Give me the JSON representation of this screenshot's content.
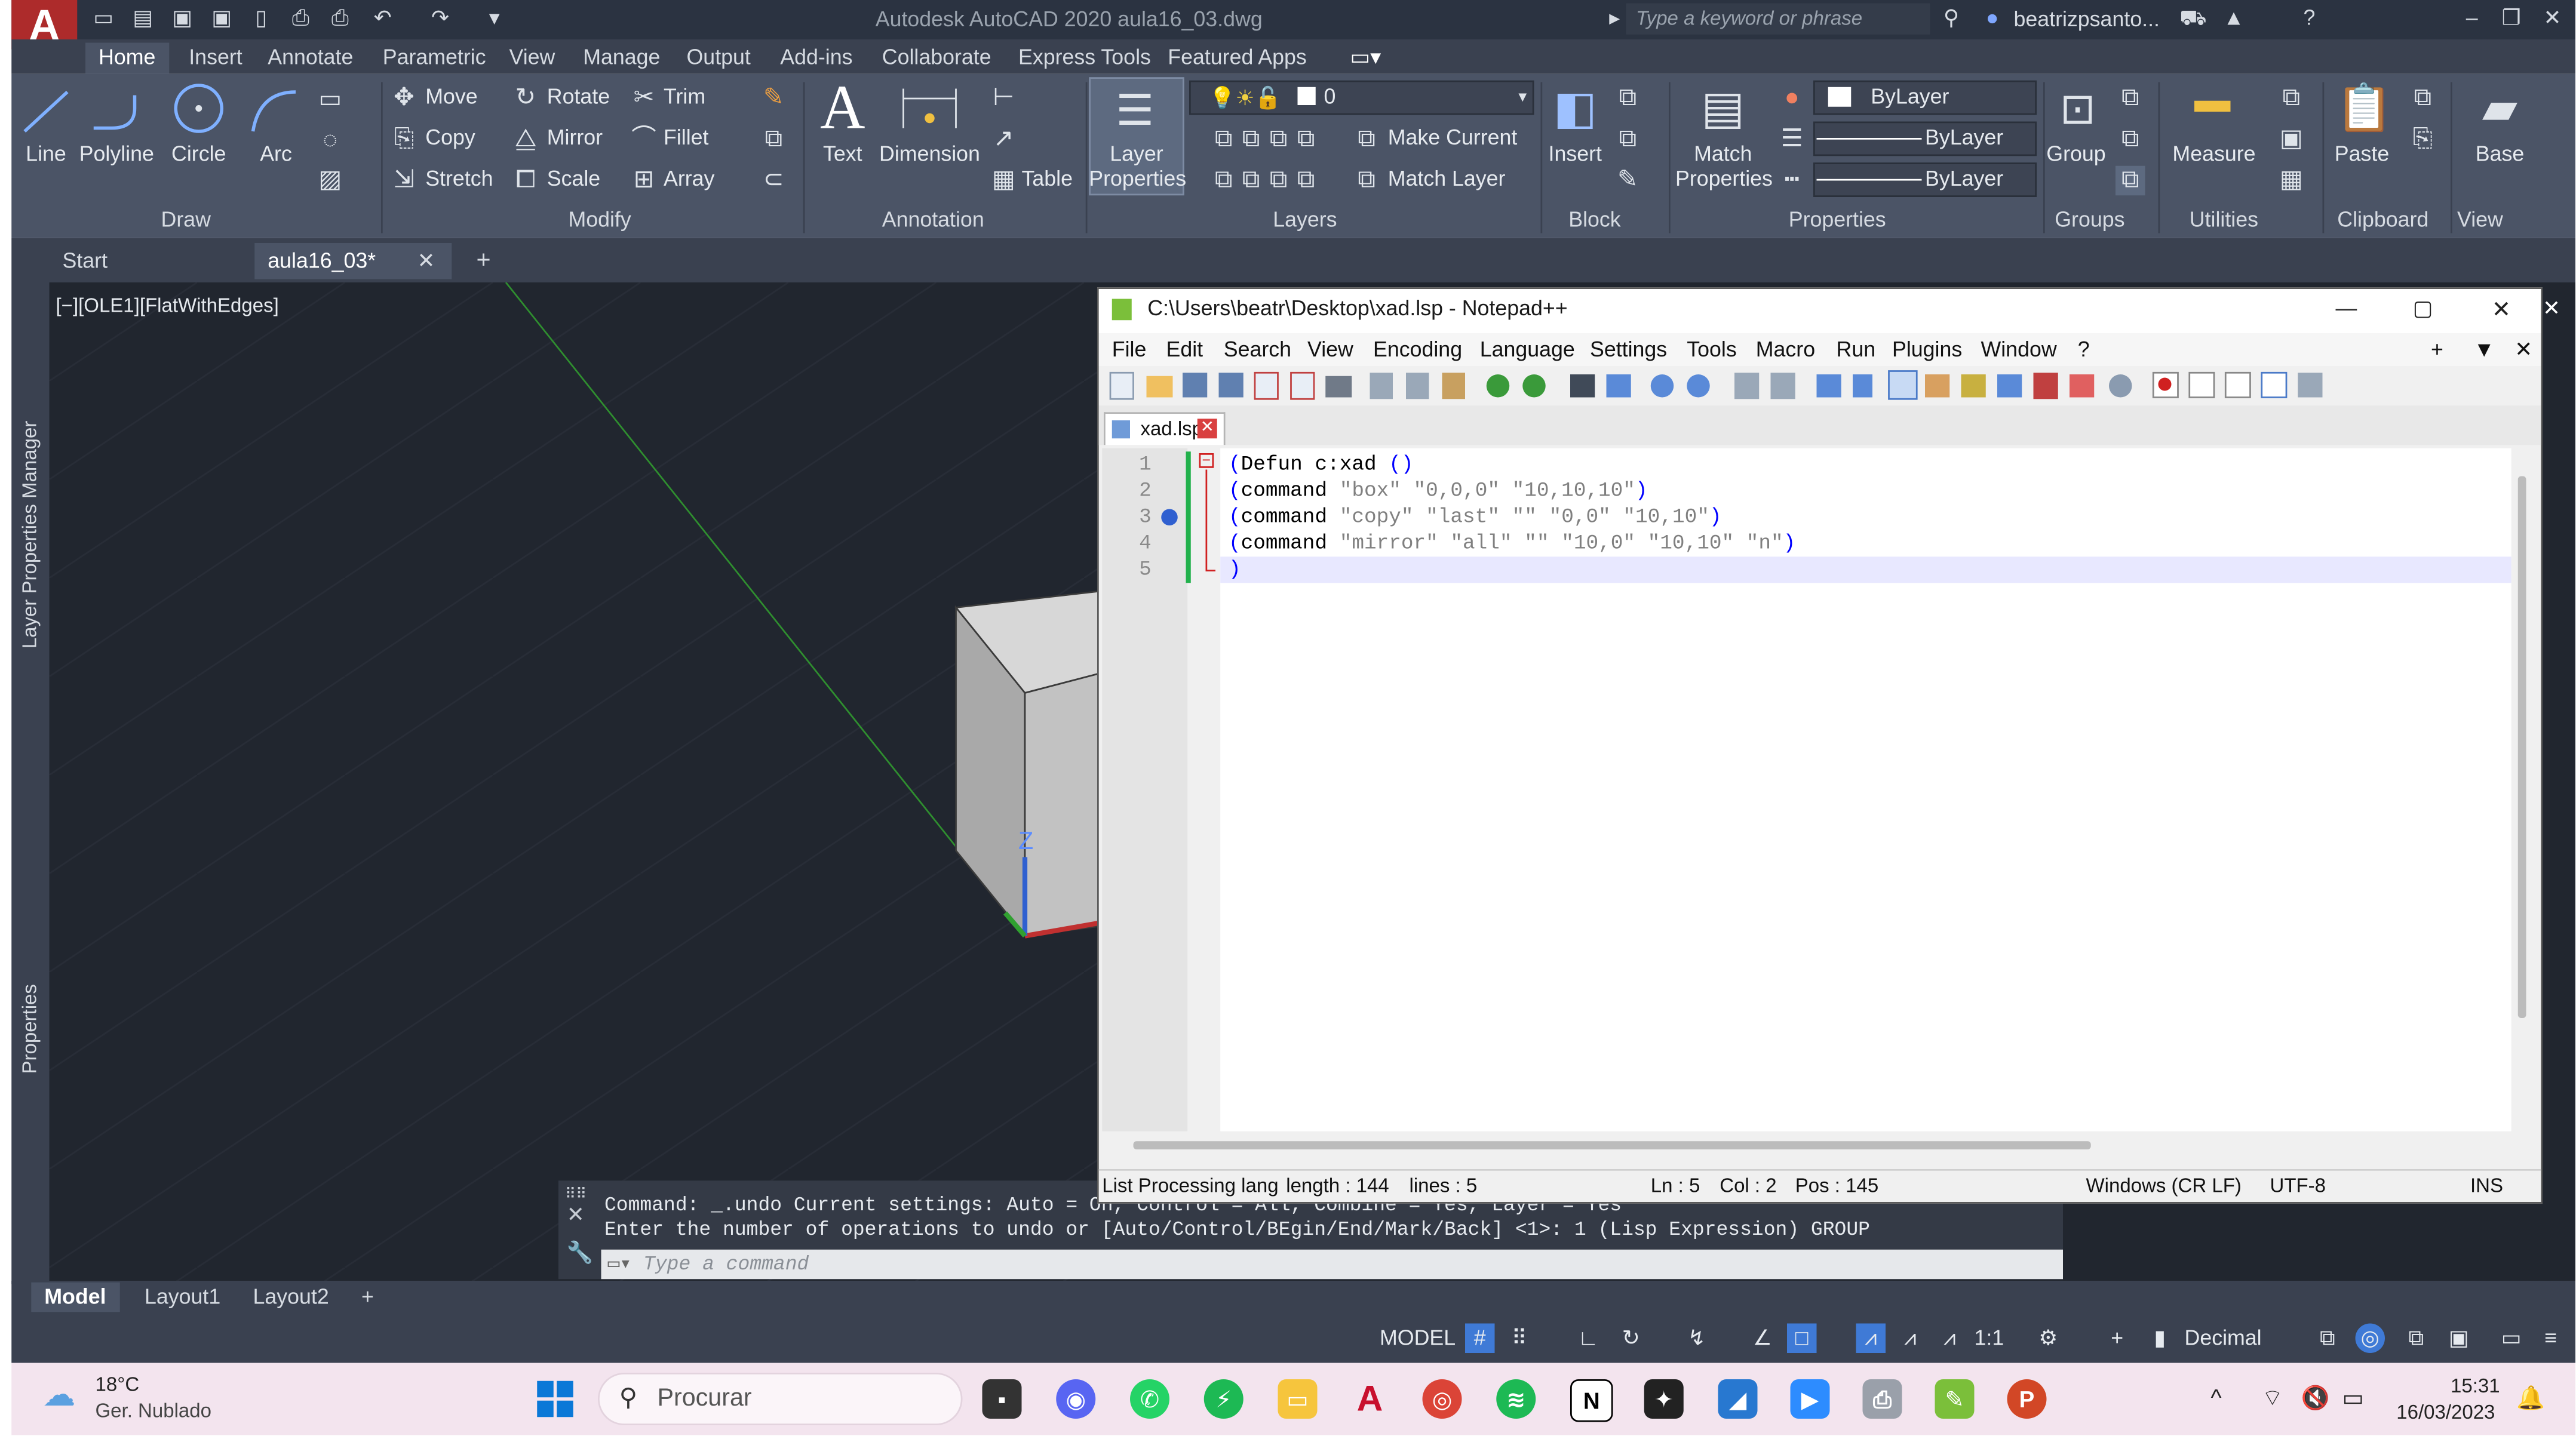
{
  "titlebar": {
    "app_logo": "A",
    "title": "Autodesk AutoCAD 2020    aula16_03.dwg",
    "search_placeholder": "Type a keyword or phrase",
    "user": "beatrizpsanto..."
  },
  "ribbon_tabs": [
    "Home",
    "Insert",
    "Annotate",
    "Parametric",
    "View",
    "Manage",
    "Output",
    "Add-ins",
    "Collaborate",
    "Express Tools",
    "Featured Apps"
  ],
  "ribbon": {
    "draw": {
      "title": "Draw",
      "line": "Line",
      "polyline": "Polyline",
      "circle": "Circle",
      "arc": "Arc"
    },
    "modify": {
      "title": "Modify",
      "move": "Move",
      "rotate": "Rotate",
      "trim": "Trim",
      "copy": "Copy",
      "mirror": "Mirror",
      "fillet": "Fillet",
      "stretch": "Stretch",
      "scale": "Scale",
      "array": "Array"
    },
    "annotation": {
      "title": "Annotation",
      "text": "Text",
      "dimension": "Dimension",
      "table": "Table"
    },
    "layers": {
      "title": "Layers",
      "layer_properties_1": "Layer",
      "layer_properties_2": "Properties",
      "current_layer": "0",
      "make_current": "Make Current",
      "match_layer": "Match Layer"
    },
    "block": {
      "title": "Block",
      "insert": "Insert"
    },
    "properties": {
      "title": "Properties",
      "match_1": "Match",
      "match_2": "Properties",
      "color": "ByLayer",
      "linetype": "ByLayer",
      "lineweight": "ByLayer"
    },
    "groups": {
      "title": "Groups",
      "group": "Group"
    },
    "utilities": {
      "title": "Utilities",
      "measure": "Measure"
    },
    "clipboard": {
      "title": "Clipboard",
      "paste": "Paste"
    },
    "view": {
      "title": "View",
      "base": "Base"
    }
  },
  "doc_tabs": {
    "start": "Start",
    "current": "aula16_03*",
    "close": "✕",
    "add": "+"
  },
  "viewport": {
    "label": "[−][OLE1][FlatWithEdges]",
    "side_label_1": "Layer Properties Manager",
    "side_label_2": "Properties",
    "axis_z": "Z"
  },
  "command": {
    "line1": "Command: _.undo Current settings: Auto = On, Control = All, Combine = Yes, Layer = Yes",
    "line2": "Enter the number of operations to undo or [Auto/Control/BEgin/End/Mark/Back] <1>: 1 (Lisp Expression) GROUP",
    "placeholder": "Type a command"
  },
  "layout_tabs": [
    "Model",
    "Layout1",
    "Layout2",
    "+"
  ],
  "status": {
    "model": "MODEL",
    "scale": "1:1",
    "units": "Decimal"
  },
  "notepad": {
    "title": "C:\\Users\\beatr\\Desktop\\xad.lsp - Notepad++",
    "menu": [
      "File",
      "Edit",
      "Search",
      "View",
      "Encoding",
      "Language",
      "Settings",
      "Tools",
      "Macro",
      "Run",
      "Plugins",
      "Window",
      "?"
    ],
    "menu_right_plus": "+",
    "menu_right_down": "▼",
    "menu_right_close": "✕",
    "file_tab": "xad.lsp",
    "code_lines": [
      {
        "num": "1",
        "text": "(Defun c:xad ()"
      },
      {
        "num": "2",
        "text": "(command \"box\" \"0,0,0\" \"10,10,10\")"
      },
      {
        "num": "3",
        "text": "(command \"copy\" \"last\" \"\" \"0,0\" \"10,10\")"
      },
      {
        "num": "4",
        "text": "(command \"mirror\" \"all\" \"\" \"10,0\" \"10,10\" \"n\")"
      },
      {
        "num": "5",
        "text": ")"
      }
    ],
    "status": {
      "lang": "List Processing langu",
      "length": "length : 144",
      "lines": "lines : 5",
      "ln": "Ln : 5",
      "col": "Col : 2",
      "pos": "Pos : 145",
      "eol": "Windows (CR LF)",
      "enc": "UTF-8",
      "ins": "INS"
    }
  },
  "taskbar": {
    "weather_temp": "18°C",
    "weather_desc": "Ger. Nublado",
    "search": "Procurar",
    "time": "15:31",
    "date": "16/03/2023"
  },
  "colors": {
    "ribbon": "#4b5466",
    "canvas": "#21262f",
    "accent_red": "#ad2b2b",
    "taskbar": "#f3e4ee"
  }
}
